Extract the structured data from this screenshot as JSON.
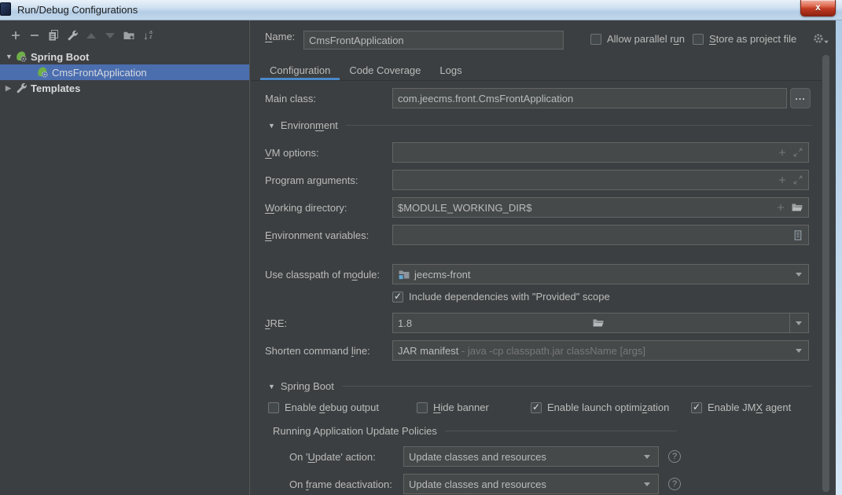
{
  "titlebar": {
    "title": "Run/Debug Configurations",
    "close": "x"
  },
  "colors": {
    "accent_blue": "#4a88c7",
    "selection_blue": "#4b6eaf",
    "spring_green": "#6fae49",
    "dialog_bg": "#3c3f41",
    "field_bg": "#45494a",
    "close_red": "#c13a23"
  },
  "toolbar": {
    "icons": [
      "add-icon",
      "remove-icon",
      "copy-icon",
      "edit-defaults-wrench-icon",
      "move-up-icon",
      "move-down-icon",
      "new-folder-icon",
      "sort-alphabetically-icon"
    ],
    "sort_a": "a",
    "sort_z": "z"
  },
  "tree": {
    "group": {
      "label": "Spring Boot"
    },
    "selected": {
      "label": "CmsFrontApplication"
    },
    "templates": {
      "label": "Templates"
    }
  },
  "header": {
    "name_label": {
      "text": "Name:",
      "key": "N"
    },
    "name_value": "CmsFrontApplication",
    "allow_parallel": {
      "text": "Allow parallel run",
      "key": "u",
      "checked": false
    },
    "store_project": {
      "text": "Store as project file",
      "key": "S",
      "checked": false
    }
  },
  "tabs": [
    {
      "label": "Configuration",
      "active": true
    },
    {
      "label": "Code Coverage",
      "active": false
    },
    {
      "label": "Logs",
      "active": false
    }
  ],
  "config": {
    "main_class": {
      "label": "Main class:",
      "value": "com.jeecms.front.CmsFrontApplication",
      "browse": "..."
    },
    "environment_section": {
      "text": "Environment",
      "key": "m"
    },
    "vm_options": {
      "label": {
        "text": "VM options:",
        "key": "V"
      },
      "value": ""
    },
    "program_arguments": {
      "label": {
        "text": "Program arguments:",
        "key": "g",
        "nth": 2
      },
      "value": ""
    },
    "working_directory": {
      "label": {
        "text": "Working directory:",
        "key": "W"
      },
      "value": "$MODULE_WORKING_DIR$"
    },
    "environment_variables": {
      "label": {
        "text": "Environment variables:",
        "key": "E"
      },
      "value": ""
    },
    "use_classpath": {
      "label": {
        "text": "Use classpath of module:",
        "key": "o",
        "nth": 2
      },
      "value": "jeecms-front"
    },
    "include_provided": {
      "label": "Include dependencies with \"Provided\" scope",
      "checked": true
    },
    "jre": {
      "label": {
        "text": "JRE:",
        "key": "J"
      },
      "value": "1.8"
    },
    "shorten": {
      "label": {
        "text": "Shorten command line:",
        "key": "l"
      },
      "value_primary": "JAR manifest",
      "value_secondary": " - java -cp classpath.jar className [args]"
    }
  },
  "spring_boot": {
    "section": {
      "text": "Spring Boot",
      "key": "g"
    },
    "checkboxes": [
      {
        "label": {
          "text": "Enable debug output",
          "key": "d"
        },
        "checked": false
      },
      {
        "label": {
          "text": "Hide banner",
          "key": "H"
        },
        "checked": false
      },
      {
        "label": {
          "text": "Enable launch optimization",
          "key": "z"
        },
        "checked": true
      },
      {
        "label": {
          "text": "Enable JMX agent",
          "key": "X"
        },
        "checked": true
      }
    ],
    "update_policies": {
      "section": "Running Application Update Policies",
      "on_update": {
        "label": {
          "text": "On 'Update' action:",
          "key": "U"
        },
        "value": "Update classes and resources"
      },
      "on_frame": {
        "label": {
          "text": "On frame deactivation:",
          "key": "f"
        },
        "value": "Update classes and resources"
      }
    }
  }
}
